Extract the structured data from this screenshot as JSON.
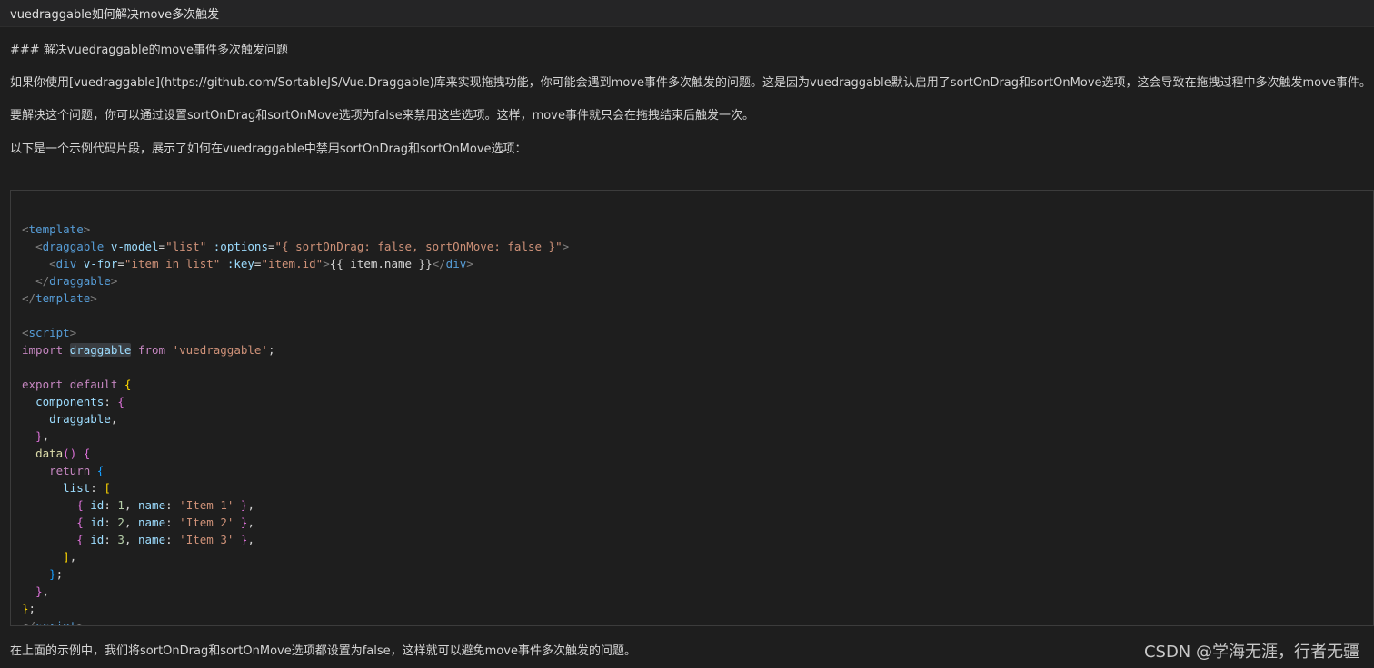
{
  "window": {
    "title": "vuedraggable如何解决move多次触发"
  },
  "article": {
    "heading": "### 解决vuedraggable的move事件多次触发问题",
    "para1": "如果你使用[vuedraggable](https://github.com/SortableJS/Vue.Draggable)库来实现拖拽功能，你可能会遇到move事件多次触发的问题。这是因为vuedraggable默认启用了sortOnDrag和sortOnMove选项，这会导致在拖拽过程中多次触发move事件。",
    "para2": "要解决这个问题，你可以通过设置sortOnDrag和sortOnMove选项为false来禁用这些选项。这样，move事件就只会在拖拽结束后触发一次。",
    "para3": "以下是一个示例代码片段，展示了如何在vuedraggable中禁用sortOnDrag和sortOnMove选项：",
    "para4": "在上面的示例中，我们将sortOnDrag和sortOnMove选项都设置为false，这样就可以避免move事件多次触发的问题。"
  },
  "code": {
    "l1_tag": "template",
    "l2_tag": "draggable",
    "l2_attr1": "v-model",
    "l2_val1": "\"list\"",
    "l2_attr2": ":options",
    "l2_val2": "\"{ sortOnDrag: false, sortOnMove: false }\"",
    "l3_tag": "div",
    "l3_attr1": "v-for",
    "l3_val1": "\"item in list\"",
    "l3_attr2": ":key",
    "l3_val2": "\"item.id\"",
    "l3_text": "{{ item.name }}",
    "l3_close": "div",
    "l4_tag": "draggable",
    "l5_tag": "template",
    "l7_tag": "script",
    "l8_import": "import",
    "l8_name": "draggable",
    "l8_from": "from",
    "l8_mod": "'vuedraggable'",
    "l10_export": "export",
    "l10_default": "default",
    "l11_prop": "components",
    "l12_name": "draggable",
    "l14_fn": "data",
    "l15_return": "return",
    "l16_prop": "list",
    "items": [
      {
        "id_key": "id",
        "id": "1",
        "name_key": "name",
        "name": "'Item 1'"
      },
      {
        "id_key": "id",
        "id": "2",
        "name_key": "name",
        "name": "'Item 2'"
      },
      {
        "id_key": "id",
        "id": "3",
        "name_key": "name",
        "name": "'Item 3'"
      }
    ],
    "l23_tag": "script"
  },
  "watermark": "CSDN @学海无涯，行者无疆"
}
